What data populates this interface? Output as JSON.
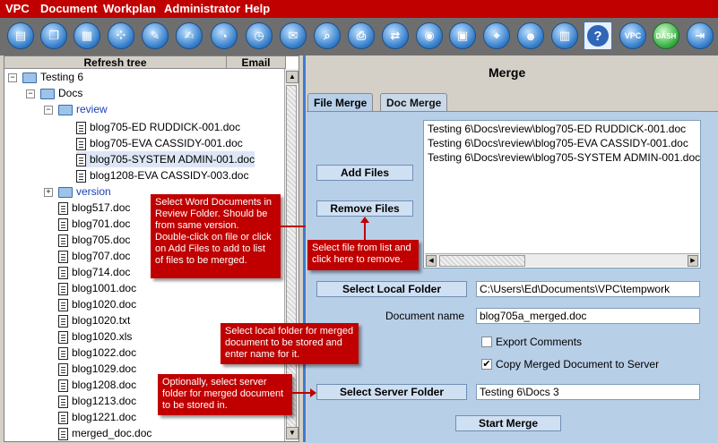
{
  "menu": [
    "VPC",
    "Document",
    "Workplan",
    "Administrator",
    "Help"
  ],
  "toolbar": {
    "icons": [
      "document-tools-icon",
      "copy-icon",
      "color-palette-icon",
      "grid-icon",
      "edit-check-icon",
      "edit-form-icon",
      "clock-document-icon",
      "mail-icon",
      "search-icon",
      "printer-icon",
      "compare-icon",
      "color-wheel-icon",
      "monitor-icon",
      "broadcast-icon",
      "users-icon",
      "cards-icon",
      "help-icon",
      "vpc-icon",
      "dash-icon",
      "exit-icon"
    ],
    "vpc_label": "VPC",
    "dash_label": "DASH",
    "help_label": "?"
  },
  "tree": {
    "header_refresh": "Refresh tree",
    "header_email": "Email",
    "root": "Testing 6",
    "docs": "Docs",
    "review": "review",
    "review_files": [
      "blog705-ED RUDDICK-001.doc",
      "blog705-EVA CASSIDY-001.doc",
      "blog705-SYSTEM ADMIN-001.doc",
      "blog1208-EVA CASSIDY-003.doc"
    ],
    "version": "version",
    "doc_files": [
      "blog517.doc",
      "blog701.doc",
      "blog705.doc",
      "blog707.doc",
      "blog714.doc",
      "blog1001.doc",
      "blog1020.doc",
      "blog1020.txt",
      "blog1020.xls",
      "blog1022.doc",
      "blog1029.doc",
      "blog1208.doc",
      "blog1213.doc",
      "blog1221.doc",
      "merged_doc.doc"
    ]
  },
  "merge": {
    "title": "Merge",
    "tab_file_merge": "File Merge",
    "tab_doc_merge": "Doc Merge",
    "add_files": "Add Files",
    "remove_files": "Remove Files",
    "file_list": [
      "Testing 6\\Docs\\review\\blog705-ED RUDDICK-001.doc",
      "Testing 6\\Docs\\review\\blog705-EVA CASSIDY-001.doc",
      "Testing 6\\Docs\\review\\blog705-SYSTEM ADMIN-001.doc"
    ],
    "select_local_folder": "Select Local Folder",
    "local_folder_value": "C:\\Users\\Ed\\Documents\\VPC\\tempwork",
    "document_name_label": "Document name",
    "document_name_value": "blog705a_merged.doc",
    "export_comments": "Export Comments",
    "copy_merged": "Copy Merged Document to Server",
    "select_server_folder": "Select Server Folder",
    "server_folder_value": "Testing 6\\Docs 3",
    "start_merge": "Start Merge"
  },
  "callouts": {
    "select_docs": "Select Word Documents in Review Folder.  Should be from same version.  Double-click on file or click on Add Files to add to list of files to be merged.",
    "remove": "Select file from list and click here to remove.",
    "local": "Select local folder for merged document to be stored and enter name for it.",
    "server": "Optionally, select server folder for merged document to be stored in."
  }
}
